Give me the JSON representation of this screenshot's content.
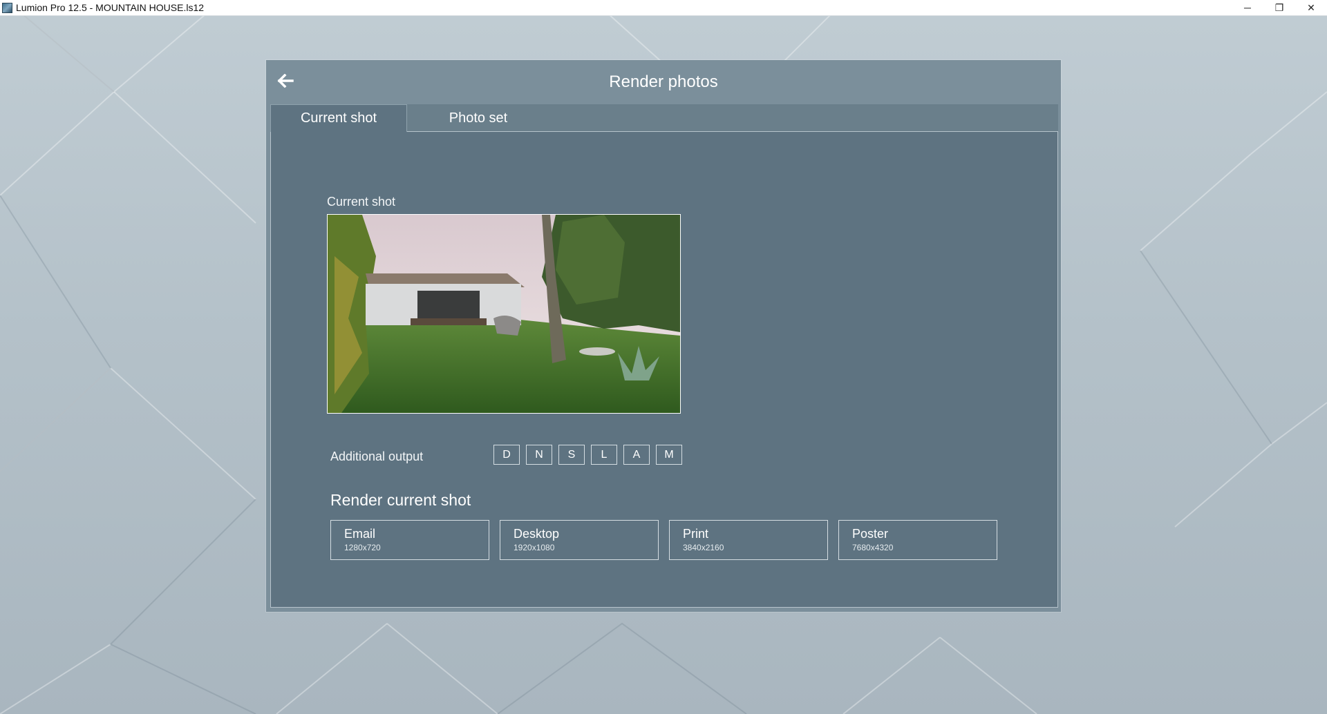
{
  "window": {
    "title": "Lumion Pro 12.5 - MOUNTAIN HOUSE.ls12",
    "minimize": "─",
    "maximize": "❐",
    "close": "✕"
  },
  "dialog": {
    "title": "Render photos",
    "back_icon": "arrow-left-icon"
  },
  "tabs": [
    {
      "label": "Current shot",
      "active": true
    },
    {
      "label": "Photo set",
      "active": false
    }
  ],
  "current_shot": {
    "label": "Current shot"
  },
  "additional_output": {
    "label": "Additional output",
    "buttons": [
      "D",
      "N",
      "S",
      "L",
      "A",
      "M"
    ]
  },
  "render": {
    "heading": "Render current shot",
    "presets": [
      {
        "label": "Email",
        "resolution": "1280x720"
      },
      {
        "label": "Desktop",
        "resolution": "1920x1080"
      },
      {
        "label": "Print",
        "resolution": "3840x2160"
      },
      {
        "label": "Poster",
        "resolution": "7680x4320"
      }
    ]
  },
  "colors": {
    "dialog_bg": "#7b8f9b",
    "content_bg": "#5e7381",
    "text": "#ffffff"
  }
}
